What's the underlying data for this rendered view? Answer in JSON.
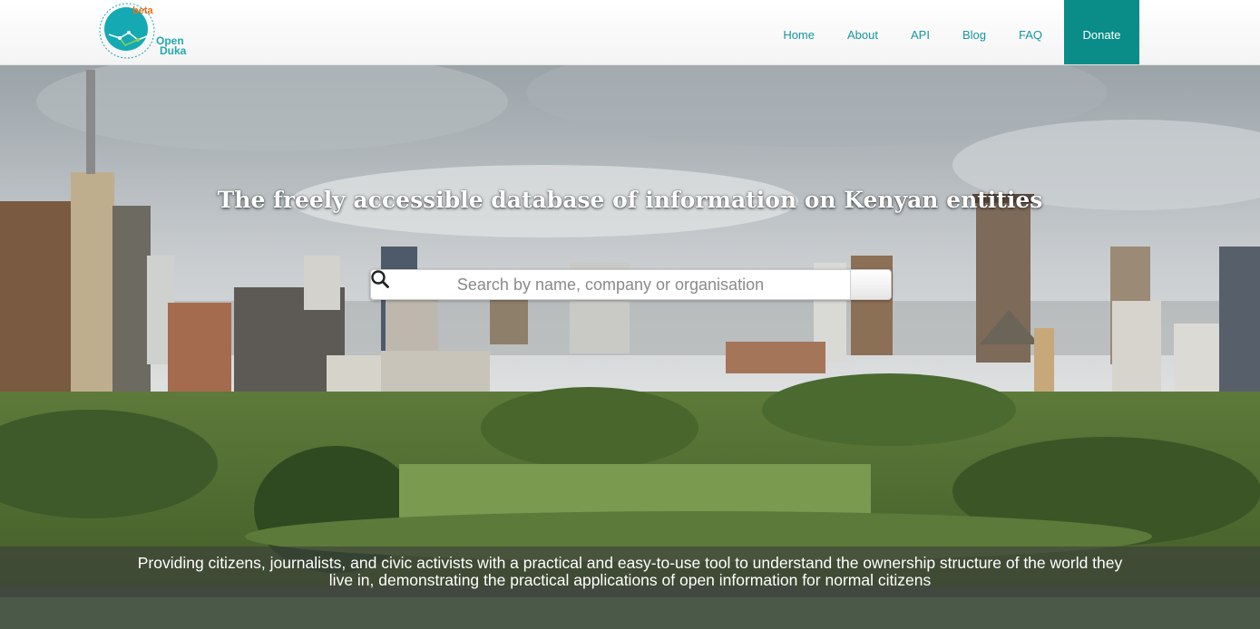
{
  "brand": {
    "beta_label": "beta",
    "name_line1": "Open",
    "name_line2": "Duka",
    "colors": {
      "accent": "#0a8c89",
      "logo_circle": "#15a9b4",
      "beta": "#e8701a"
    }
  },
  "nav": {
    "items": [
      {
        "label": "Home"
      },
      {
        "label": "About"
      },
      {
        "label": "API"
      },
      {
        "label": "Blog"
      },
      {
        "label": "FAQ"
      }
    ],
    "donate_label": "Donate"
  },
  "hero": {
    "tagline": "The freely accessible database of information on Kenyan entities",
    "background": "Nairobi city skyline photograph"
  },
  "search": {
    "placeholder": "Search by name, company or organisation",
    "value": "",
    "button_icon": "search-icon"
  },
  "mission": {
    "text": "Providing citizens, journalists, and civic activists with a practical and easy-to-use tool to understand the ownership structure of the world they live in, demonstrating the practical applications of open information for normal citizens"
  }
}
